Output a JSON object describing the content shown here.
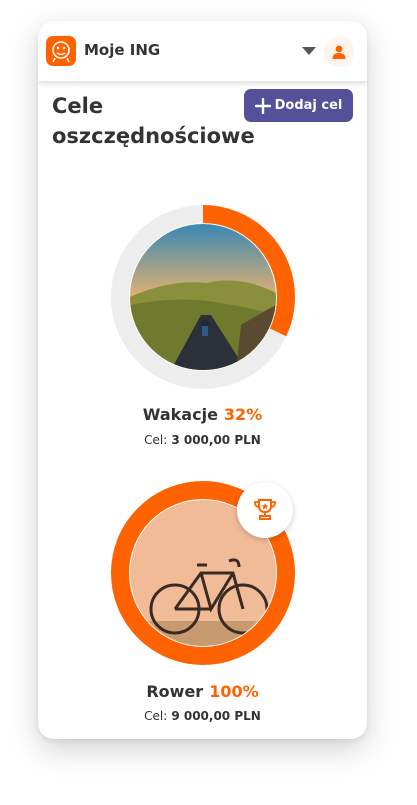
{
  "header": {
    "app_title": "Moje ING",
    "icons": {
      "logo": "ing-lion-logo",
      "dropdown": "caret-down-icon",
      "avatar": "user-icon"
    }
  },
  "page": {
    "title_line1": "Cele",
    "title_line2": "oszczędnościowe",
    "add_button_label": "Dodaj cel"
  },
  "goals": [
    {
      "name": "Wakacje",
      "percent_label": "32%",
      "progress": 0.32,
      "target_label": "Cel:",
      "target_amount": "3 000,00 PLN",
      "image": "cyclist-on-mountain-road"
    },
    {
      "name": "Rower",
      "percent_label": "100%",
      "progress": 1.0,
      "target_label": "Cel:",
      "target_amount": "9 000,00 PLN",
      "image": "bicycle-against-wall",
      "badge": "trophy-icon"
    }
  ],
  "colors": {
    "accent": "#ff6200",
    "button": "#525199",
    "track": "#ededed",
    "text": "#333333"
  }
}
